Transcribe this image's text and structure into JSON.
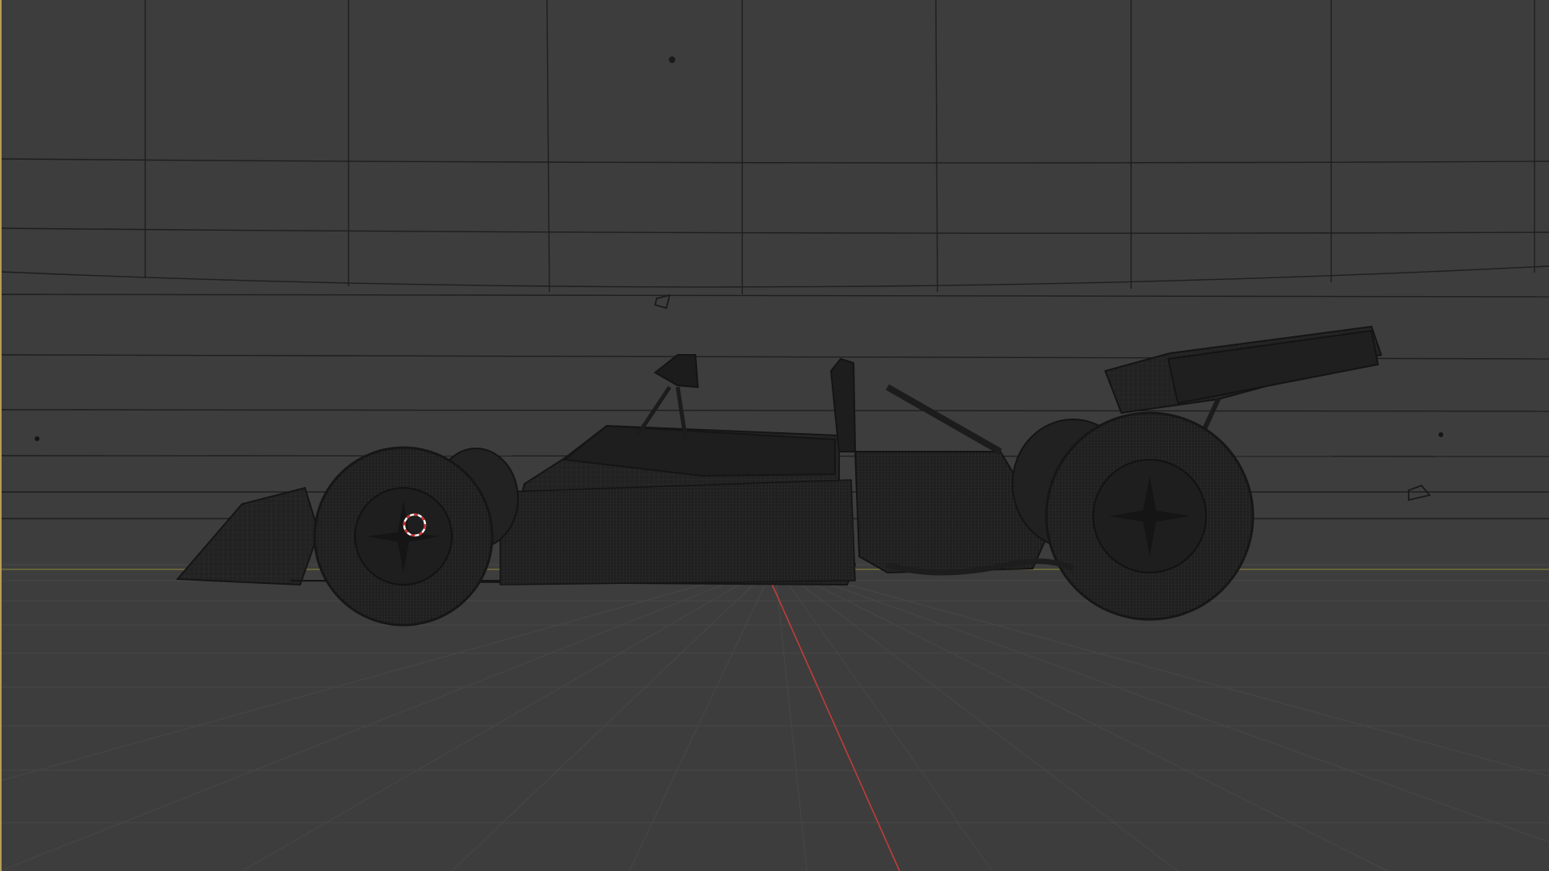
{
  "viewport": {
    "mode": "wireframe",
    "view": "side",
    "background_color": "#3d3d3d",
    "active_border_color": "#b89c57",
    "wire_color": "#1a1a1a",
    "floor_grid_color": "#4a4a4a",
    "x_axis_color": "#c23b3b",
    "y_axis_color": "#8f8a3a",
    "cursor_color": "#d22e2e"
  },
  "scene_objects": [
    {
      "name": "race-car",
      "type": "mesh"
    },
    {
      "name": "backdrop",
      "type": "mesh"
    },
    {
      "name": "camera",
      "type": "camera"
    },
    {
      "name": "light",
      "type": "light"
    }
  ],
  "icons": {
    "3d-cursor": "3d-cursor-icon",
    "light": "light-icon",
    "camera": "camera-icon"
  }
}
